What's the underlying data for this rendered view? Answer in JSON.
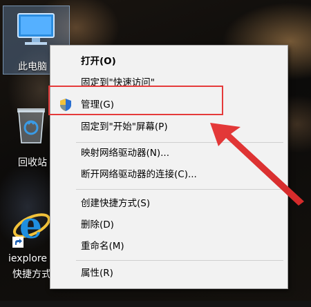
{
  "desktop": {
    "icons": [
      {
        "label": "此电脑"
      },
      {
        "label": "回收站"
      },
      {
        "label": "iexplore",
        "sublabel": "快捷方式"
      }
    ]
  },
  "context_menu": {
    "items": [
      {
        "label": "打开(O)",
        "bold": true
      },
      {
        "label": "固定到\"快速访问\""
      },
      {
        "label": "管理(G)",
        "icon": "shield-icon"
      },
      {
        "label": "固定到\"开始\"屏幕(P)"
      },
      {
        "label": "映射网络驱动器(N)..."
      },
      {
        "label": "断开网络驱动器的连接(C)..."
      },
      {
        "label": "创建快捷方式(S)"
      },
      {
        "label": "删除(D)"
      },
      {
        "label": "重命名(M)"
      },
      {
        "label": "属性(R)"
      }
    ]
  },
  "annotation": {
    "highlight_color": "#e53a3a",
    "arrow_color": "#e53a3a"
  }
}
